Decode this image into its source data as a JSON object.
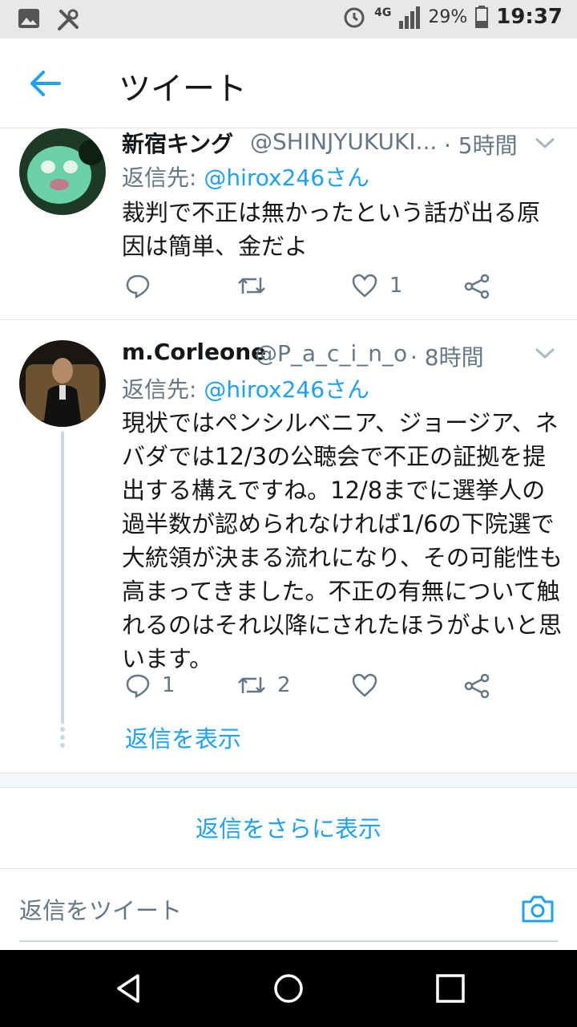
{
  "status_bar": {
    "network": "4G",
    "battery": "29%",
    "time": "19:37"
  },
  "header": {
    "title": "ツイート"
  },
  "tweets": [
    {
      "name": "新宿キング",
      "handle": "@SHINJYUKUKI...",
      "time": "· 5時間",
      "reply_prefix": "返信先: ",
      "reply_to": "@hirox246さん",
      "text": "裁判で不正は無かったという話が出る原因は簡単、金だよ",
      "reply_count": "",
      "retweet_count": "",
      "like_count": "1"
    },
    {
      "name": "m.Corleone",
      "handle": "@P_a_c_i_n_o",
      "time": "· 8時間",
      "reply_prefix": "返信先: ",
      "reply_to": "@hirox246さん",
      "text": "現状ではペンシルベニア、ジョージア、ネバダでは12/3の公聴会で不正の証拠を提出する構えですね。12/8までに選挙人の過半数が認められなければ1/6の下院選で大統領が決まる流れになり、その可能性も高まってきました。不正の有無について触れるのはそれ以降にされたほうがよいと思います。",
      "reply_count": "1",
      "retweet_count": "2",
      "like_count": ""
    }
  ],
  "show_replies": "返信を表示",
  "more_replies": "返信をさらに表示",
  "compose": {
    "placeholder": "返信をツイート"
  },
  "colors": {
    "accent": "#1da1f2",
    "secondary_text": "#657786",
    "divider": "#dfe3e6"
  }
}
